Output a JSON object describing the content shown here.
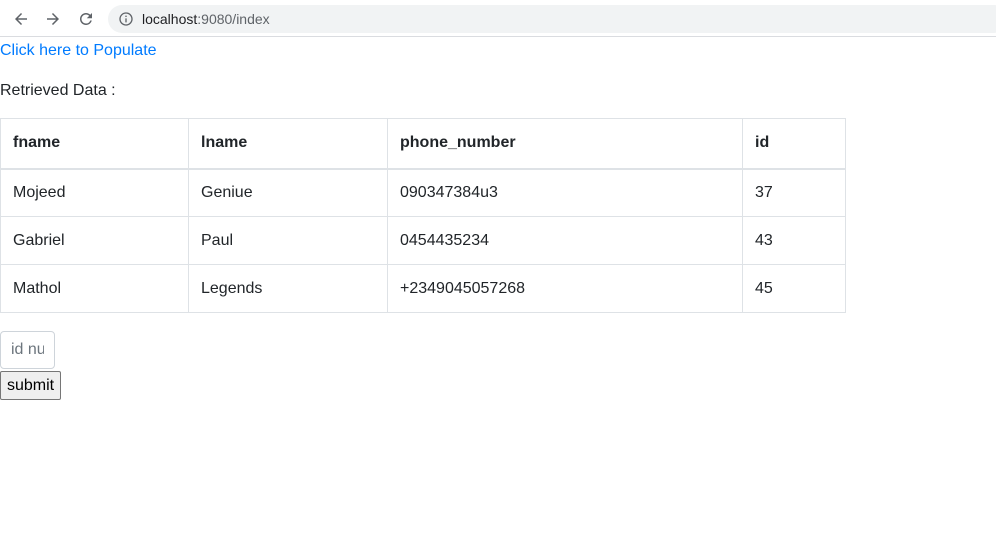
{
  "browser": {
    "url_host": "localhost",
    "url_rest": ":9080/index",
    "icons": {
      "back": "arrow-left-icon",
      "forward": "arrow-right-icon",
      "reload": "reload-icon",
      "info": "info-icon"
    }
  },
  "page": {
    "populate_link": "Click here to Populate",
    "retrieved_label": "Retrieved Data :",
    "table": {
      "headers": [
        "fname",
        "lname",
        "phone_number",
        "id"
      ],
      "rows": [
        [
          "Mojeed",
          "Geniue",
          "090347384u3",
          "37"
        ],
        [
          "Gabriel",
          "Paul",
          "0454435234",
          "43"
        ],
        [
          "Mathol",
          "Legends",
          "+2349045057268",
          "45"
        ]
      ]
    },
    "id_input_placeholder": "id number",
    "submit_label": "submit"
  },
  "colors": {
    "link": "#007bff",
    "border": "#dee2e6",
    "omnibox": "#f1f3f4"
  }
}
